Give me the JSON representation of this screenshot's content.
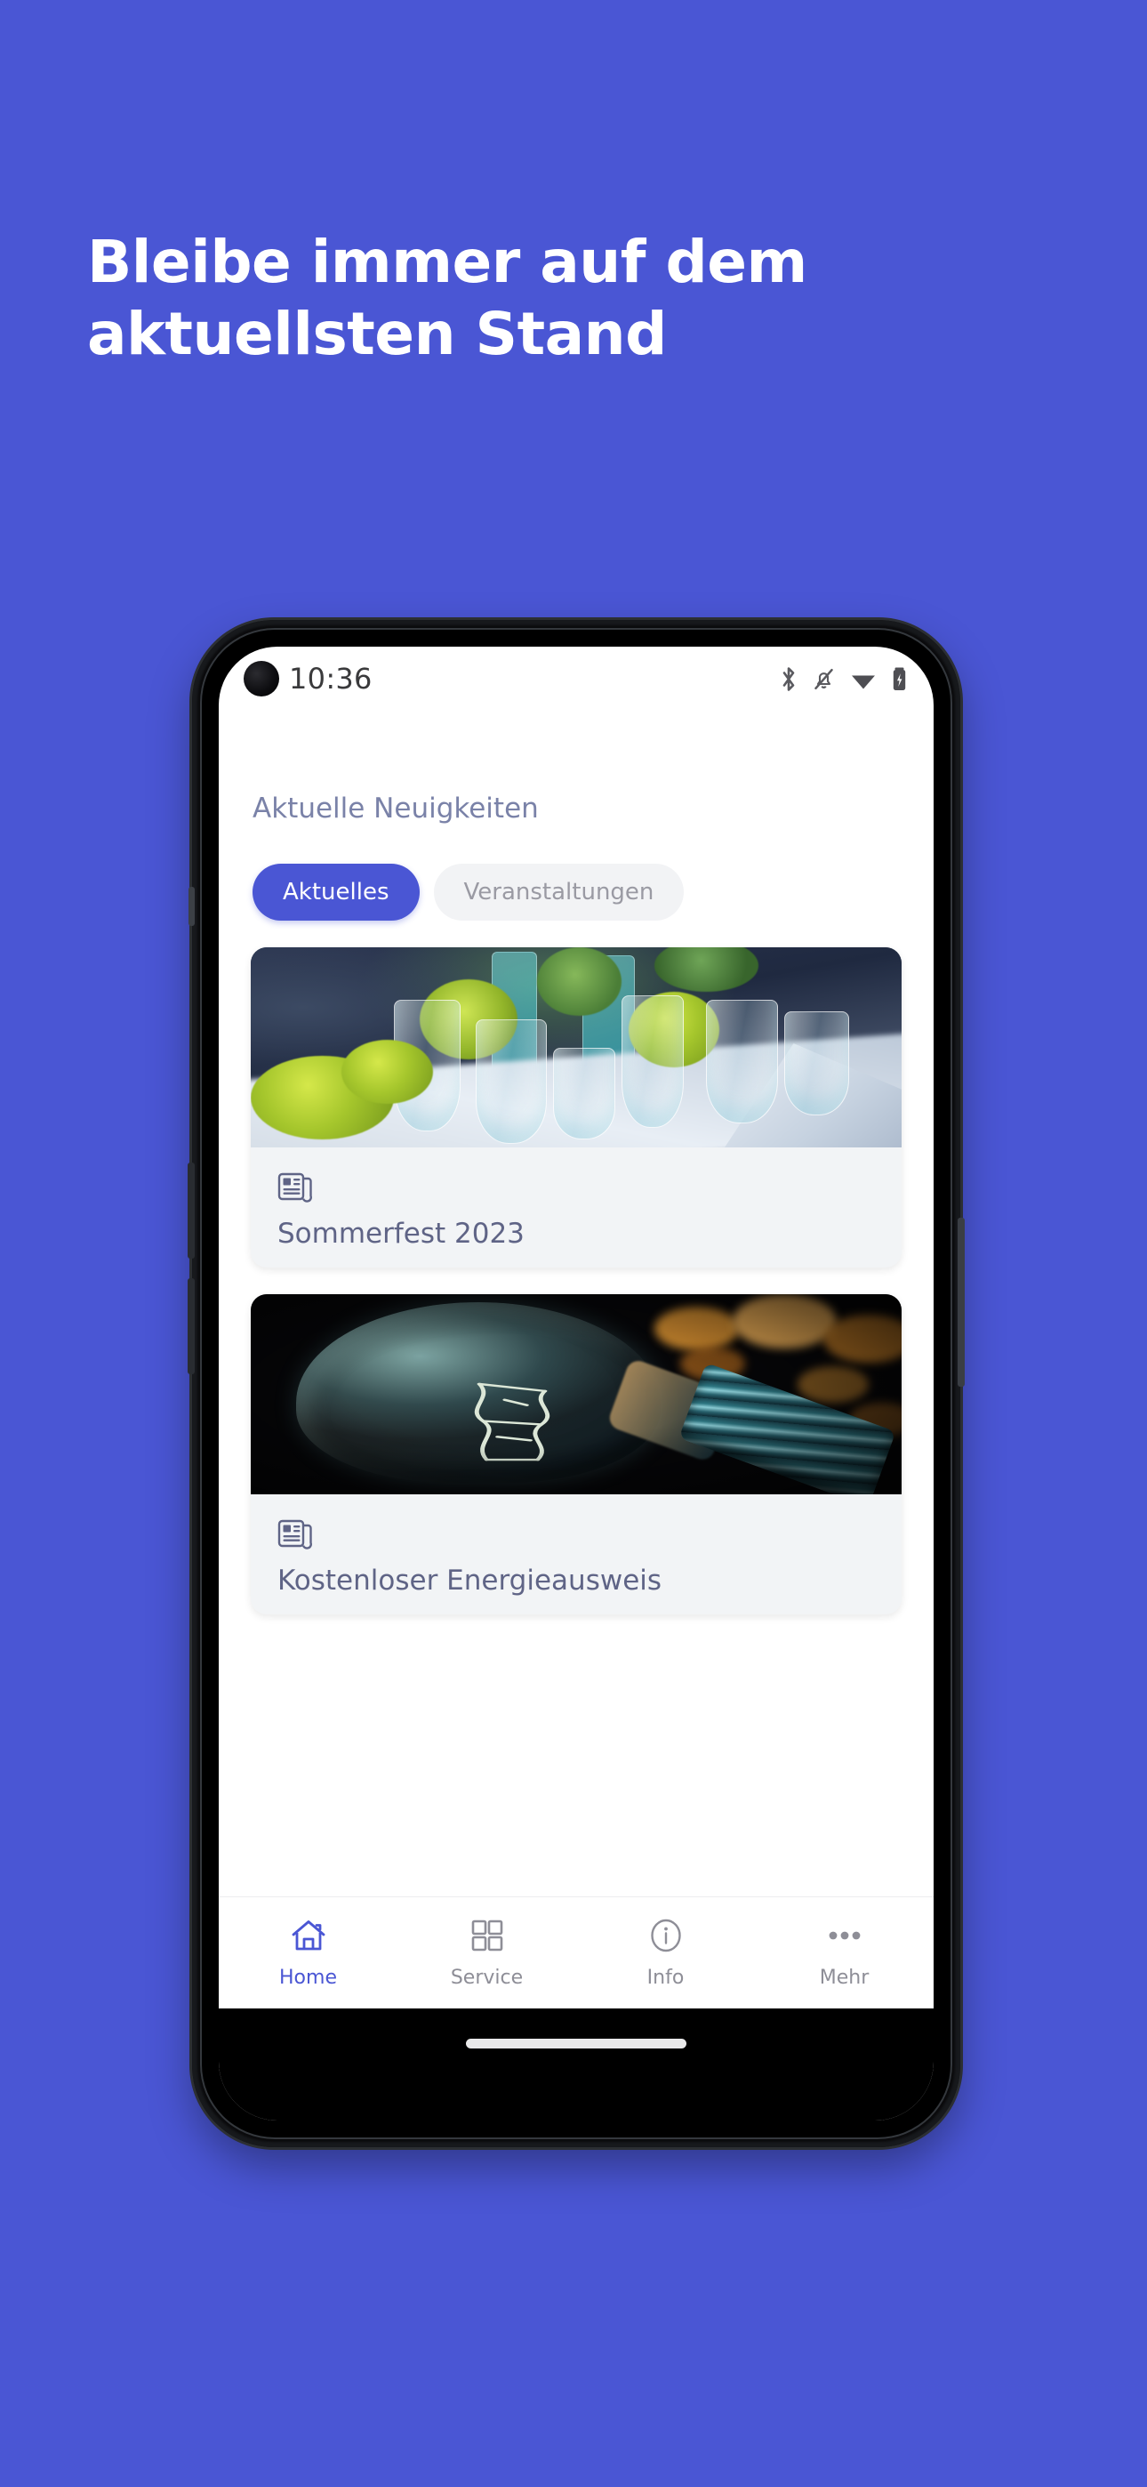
{
  "theme": {
    "brand_blue": "#4a56d4",
    "muted_text": "#8e8e97",
    "title_text": "#5f6486",
    "card_bg": "#f2f4f6"
  },
  "headline": "Bleibe immer auf dem\naktuellsten Stand",
  "phone": {
    "status_bar": {
      "time": "10:36",
      "icons": [
        "bluetooth-icon",
        "notifications-off-icon",
        "wifi-icon",
        "battery-charging-icon"
      ]
    },
    "screen": {
      "section_title": "Aktuelle Neuigkeiten",
      "tabs": [
        {
          "label": "Aktuelles",
          "active": true
        },
        {
          "label": "Veranstaltungen",
          "active": false
        }
      ],
      "cards": [
        {
          "title": "Sommerfest 2023",
          "icon": "newspaper-icon",
          "image": "banquet-table-photo"
        },
        {
          "title": "Kostenloser Energieausweis",
          "icon": "newspaper-icon",
          "image": "lightbulb-photo"
        }
      ],
      "bottom_nav": [
        {
          "label": "Home",
          "icon": "home-icon",
          "active": true
        },
        {
          "label": "Service",
          "icon": "grid-icon",
          "active": false
        },
        {
          "label": "Info",
          "icon": "info-circle-icon",
          "active": false
        },
        {
          "label": "Mehr",
          "icon": "ellipsis-icon",
          "active": false
        }
      ]
    }
  }
}
